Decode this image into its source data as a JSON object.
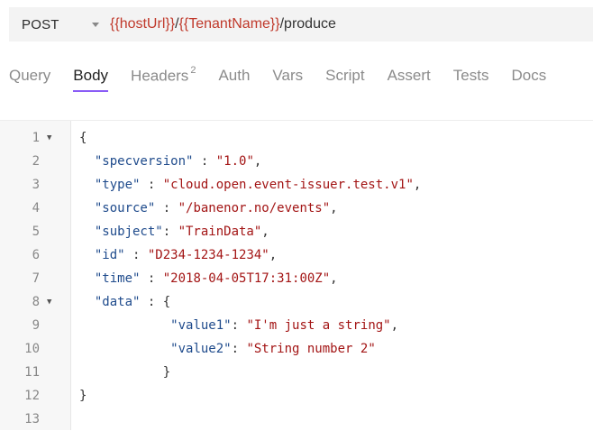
{
  "request": {
    "method": "POST",
    "url_parts": [
      "{{hostUrl}}",
      "/",
      "{{TenantName}}",
      "/produce"
    ]
  },
  "tabs": [
    {
      "label": "Query"
    },
    {
      "label": "Body",
      "active": true
    },
    {
      "label": "Headers",
      "badge": "2"
    },
    {
      "label": "Auth"
    },
    {
      "label": "Vars"
    },
    {
      "label": "Script"
    },
    {
      "label": "Assert"
    },
    {
      "label": "Tests"
    },
    {
      "label": "Docs"
    }
  ],
  "editor": {
    "lines": [
      {
        "n": "1",
        "fold": true,
        "indent": 0,
        "tokens": [
          {
            "t": "p",
            "v": "{"
          }
        ]
      },
      {
        "n": "2",
        "indent": 2,
        "tokens": [
          {
            "t": "k",
            "v": "\"specversion\""
          },
          {
            "t": "p",
            "v": " : "
          },
          {
            "t": "s",
            "v": "\"1.0\""
          },
          {
            "t": "p",
            "v": ","
          }
        ]
      },
      {
        "n": "3",
        "indent": 2,
        "tokens": [
          {
            "t": "k",
            "v": "\"type\""
          },
          {
            "t": "p",
            "v": " : "
          },
          {
            "t": "s",
            "v": "\"cloud.open.event-issuer.test.v1\""
          },
          {
            "t": "p",
            "v": ","
          }
        ]
      },
      {
        "n": "4",
        "indent": 2,
        "tokens": [
          {
            "t": "k",
            "v": "\"source\""
          },
          {
            "t": "p",
            "v": " : "
          },
          {
            "t": "s",
            "v": "\"/banenor.no/events\""
          },
          {
            "t": "p",
            "v": ","
          }
        ]
      },
      {
        "n": "5",
        "indent": 2,
        "tokens": [
          {
            "t": "k",
            "v": "\"subject\""
          },
          {
            "t": "p",
            "v": ": "
          },
          {
            "t": "s",
            "v": "\"TrainData\""
          },
          {
            "t": "p",
            "v": ","
          }
        ]
      },
      {
        "n": "6",
        "indent": 2,
        "tokens": [
          {
            "t": "k",
            "v": "\"id\""
          },
          {
            "t": "p",
            "v": " : "
          },
          {
            "t": "s",
            "v": "\"D234-1234-1234\""
          },
          {
            "t": "p",
            "v": ","
          }
        ]
      },
      {
        "n": "7",
        "indent": 2,
        "tokens": [
          {
            "t": "k",
            "v": "\"time\""
          },
          {
            "t": "p",
            "v": " : "
          },
          {
            "t": "s",
            "v": "\"2018-04-05T17:31:00Z\""
          },
          {
            "t": "p",
            "v": ","
          }
        ]
      },
      {
        "n": "8",
        "fold": true,
        "indent": 2,
        "tokens": [
          {
            "t": "k",
            "v": "\"data\""
          },
          {
            "t": "p",
            "v": " : {"
          }
        ]
      },
      {
        "n": "9",
        "indent": 12,
        "tokens": [
          {
            "t": "k",
            "v": "\"value1\""
          },
          {
            "t": "p",
            "v": ": "
          },
          {
            "t": "s",
            "v": "\"I'm just a string\""
          },
          {
            "t": "p",
            "v": ","
          }
        ]
      },
      {
        "n": "10",
        "indent": 12,
        "tokens": [
          {
            "t": "k",
            "v": "\"value2\""
          },
          {
            "t": "p",
            "v": ": "
          },
          {
            "t": "s",
            "v": "\"String number 2\""
          }
        ]
      },
      {
        "n": "11",
        "indent": 11,
        "tokens": [
          {
            "t": "p",
            "v": "}"
          }
        ]
      },
      {
        "n": "12",
        "indent": 0,
        "tokens": [
          {
            "t": "p",
            "v": "}"
          }
        ]
      },
      {
        "n": "13",
        "indent": 0,
        "tokens": []
      }
    ]
  },
  "colors": {
    "accent": "#8a5cf6",
    "variable": "#c0392b",
    "json_key": "#1f4b8c",
    "json_string": "#a31515"
  }
}
